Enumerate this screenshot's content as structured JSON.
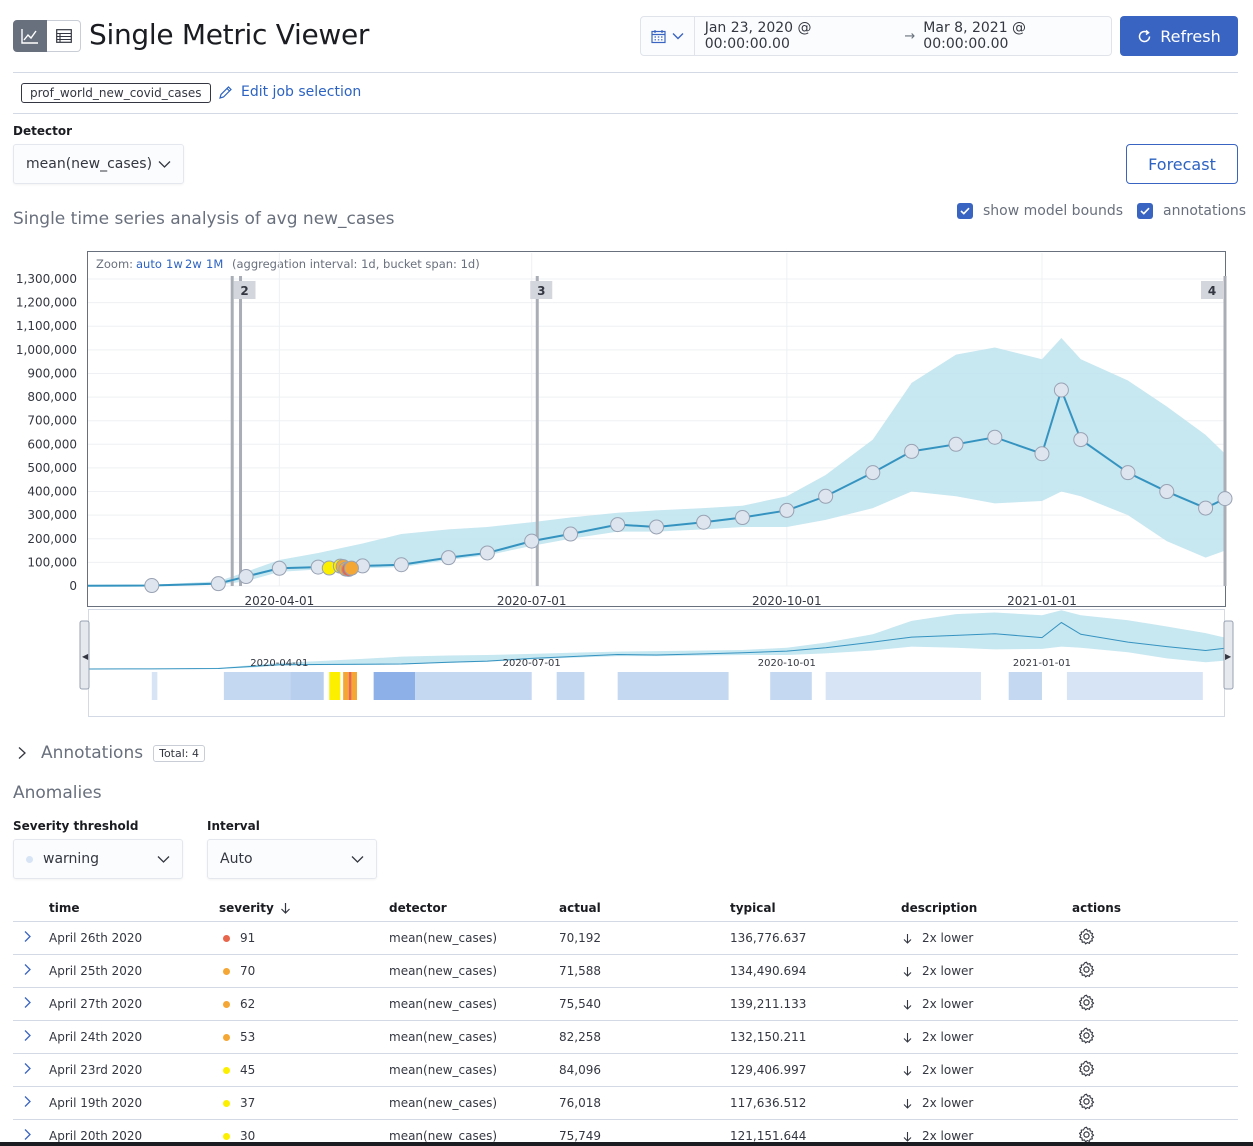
{
  "header": {
    "title": "Single Metric Viewer",
    "date_start": "Jan 23, 2020 @ 00:00:00.00",
    "date_end": "Mar 8, 2021 @ 00:00:00.00",
    "refresh_label": "Refresh"
  },
  "job": {
    "id": "prof_world_new_covid_cases",
    "edit_label": "Edit job selection"
  },
  "detector": {
    "label": "Detector",
    "value": "mean(new_cases)"
  },
  "forecast_label": "Forecast",
  "chart_section": {
    "title": "Single time series analysis of avg new_cases",
    "show_model_bounds": "show model bounds",
    "annotations_label": "annotations",
    "zoom_label": "Zoom:",
    "zoom_options": [
      "auto",
      "1w",
      "2w",
      "1M"
    ],
    "agg_info": "(aggregation interval: 1d, bucket span: 1d)"
  },
  "chart_data": {
    "type": "line",
    "title": "",
    "ylim": [
      0,
      1300000
    ],
    "yticks": [
      "1,300,000",
      "1,200,000",
      "1,100,000",
      "1,000,000",
      "900,000",
      "800,000",
      "700,000",
      "600,000",
      "500,000",
      "400,000",
      "300,000",
      "200,000",
      "100,000",
      "0"
    ],
    "xticks": [
      "2020-04-01",
      "2020-07-01",
      "2020-10-01",
      "2021-01-01"
    ],
    "annotation_markers": [
      "2",
      "3",
      "4"
    ],
    "series": [
      {
        "name": "",
        "x": [
          "2020-01-23",
          "2020-02-15",
          "2020-03-10",
          "2020-03-20",
          "2020-04-01",
          "2020-04-15",
          "2020-05-01",
          "2020-05-15",
          "2020-06-01",
          "2020-06-15",
          "2020-07-01",
          "2020-07-15",
          "2020-08-01",
          "2020-08-15",
          "2020-09-01",
          "2020-09-15",
          "2020-10-01",
          "2020-10-15",
          "2020-11-01",
          "2020-11-15",
          "2020-12-01",
          "2020-12-15",
          "2021-01-01",
          "2021-01-08",
          "2021-01-15",
          "2021-02-01",
          "2021-02-15",
          "2021-03-01",
          "2021-03-08"
        ],
        "values": [
          1000,
          2000,
          10000,
          40000,
          75000,
          80000,
          85000,
          90000,
          120000,
          140000,
          190000,
          220000,
          260000,
          250000,
          270000,
          290000,
          320000,
          380000,
          480000,
          570000,
          600000,
          630000,
          560000,
          830000,
          620000,
          480000,
          400000,
          330000,
          370000
        ]
      }
    ],
    "model_bounds_upper": [
      5000,
      5000,
      20000,
      60000,
      110000,
      140000,
      180000,
      220000,
      240000,
      250000,
      270000,
      290000,
      310000,
      320000,
      330000,
      340000,
      380000,
      470000,
      620000,
      860000,
      980000,
      1010000,
      960000,
      1050000,
      960000,
      870000,
      760000,
      640000,
      560000
    ],
    "model_bounds_lower": [
      0,
      0,
      5000,
      20000,
      60000,
      70000,
      75000,
      80000,
      110000,
      130000,
      170000,
      200000,
      230000,
      230000,
      240000,
      250000,
      250000,
      280000,
      330000,
      400000,
      380000,
      350000,
      360000,
      400000,
      380000,
      300000,
      190000,
      120000,
      150000
    ]
  },
  "annotations_section": {
    "title": "Annotations",
    "total": "Total: 4"
  },
  "anomalies": {
    "title": "Anomalies",
    "severity_label": "Severity threshold",
    "severity_value": "warning",
    "interval_label": "Interval",
    "interval_value": "Auto",
    "columns": [
      "time",
      "severity",
      "detector",
      "actual",
      "typical",
      "description",
      "actions"
    ],
    "rows": [
      {
        "time": "April 26th 2020",
        "severity": "91",
        "sev_color": "#e7664c",
        "detector": "mean(new_cases)",
        "actual": "70,192",
        "typical": "136,776.637",
        "description": "2x lower"
      },
      {
        "time": "April 25th 2020",
        "severity": "70",
        "sev_color": "#f5a735",
        "detector": "mean(new_cases)",
        "actual": "71,588",
        "typical": "134,490.694",
        "description": "2x lower"
      },
      {
        "time": "April 27th 2020",
        "severity": "62",
        "sev_color": "#f5a735",
        "detector": "mean(new_cases)",
        "actual": "75,540",
        "typical": "139,211.133",
        "description": "2x lower"
      },
      {
        "time": "April 24th 2020",
        "severity": "53",
        "sev_color": "#f5a735",
        "detector": "mean(new_cases)",
        "actual": "82,258",
        "typical": "132,150.211",
        "description": "2x lower"
      },
      {
        "time": "April 23rd 2020",
        "severity": "45",
        "sev_color": "#fcef00",
        "detector": "mean(new_cases)",
        "actual": "84,096",
        "typical": "129,406.997",
        "description": "2x lower"
      },
      {
        "time": "April 19th 2020",
        "severity": "37",
        "sev_color": "#fcef00",
        "detector": "mean(new_cases)",
        "actual": "76,018",
        "typical": "117,636.512",
        "description": "2x lower"
      },
      {
        "time": "April 20th 2020",
        "severity": "30",
        "sev_color": "#fcef00",
        "detector": "mean(new_cases)",
        "actual": "75,749",
        "typical": "121,151.644",
        "description": "2x lower"
      }
    ]
  }
}
